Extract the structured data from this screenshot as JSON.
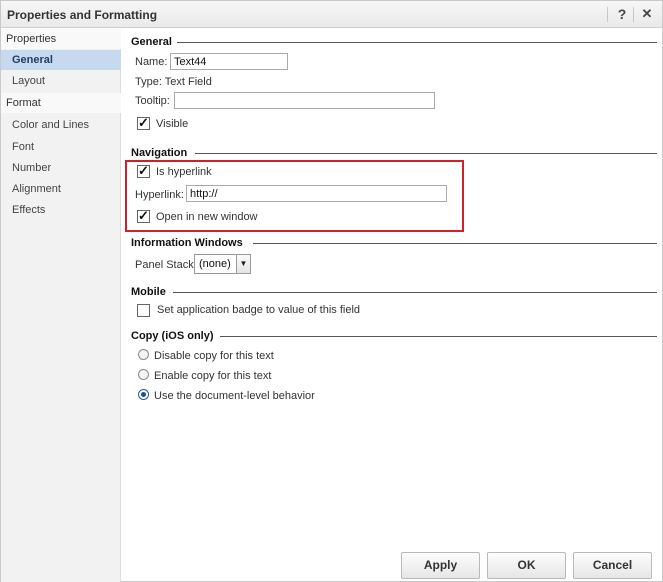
{
  "window": {
    "title": "Properties and Formatting",
    "help_glyph": "?",
    "close_glyph": "✕"
  },
  "sidebar": {
    "group1": "Properties",
    "group1_items": [
      "General",
      "Layout"
    ],
    "group2": "Format",
    "group2_items": [
      "Color and Lines",
      "Font",
      "Number",
      "Alignment",
      "Effects"
    ]
  },
  "general": {
    "heading": "General",
    "name_label": "Name:",
    "name_value": "Text44",
    "type_text": "Type: Text Field",
    "tooltip_label": "Tooltip:",
    "tooltip_value": "",
    "visible_label": "Visible",
    "visible_checked": true
  },
  "navigation": {
    "heading": "Navigation",
    "is_hyperlink_label": "Is hyperlink",
    "is_hyperlink_checked": true,
    "hyperlink_label": "Hyperlink:",
    "hyperlink_value": "http://",
    "new_window_label": "Open in new window",
    "new_window_checked": true,
    "highlight_color": "#d0202a"
  },
  "info_windows": {
    "heading": "Information Windows",
    "panel_stack_label": "Panel Stack:",
    "panel_stack_value": "(none)"
  },
  "mobile": {
    "heading": "Mobile",
    "badge_label": "Set application badge to value of this field",
    "badge_checked": false
  },
  "copy_ios": {
    "heading": "Copy (iOS only)",
    "options": [
      "Disable copy for this text",
      "Enable copy for this text",
      "Use the document-level behavior"
    ],
    "selected_index": 2
  },
  "buttons": {
    "apply": "Apply",
    "ok": "OK",
    "cancel": "Cancel"
  }
}
